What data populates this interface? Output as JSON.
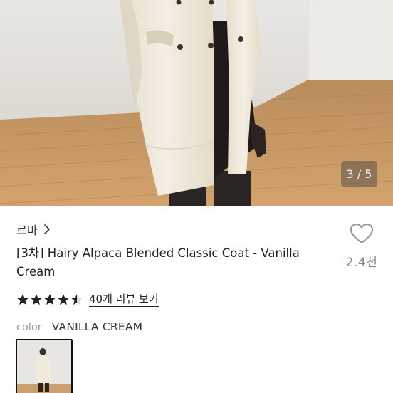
{
  "gallery": {
    "counter": "3 / 5"
  },
  "brand": {
    "name": "르바"
  },
  "product": {
    "title": "[3차] Hairy Alpaca Blended Classic Coat - Vanilla Cream",
    "wish_count": "2.4천"
  },
  "rating": {
    "value": 4.5,
    "out_of": 5,
    "review_link": "40개 리뷰 보기"
  },
  "option": {
    "label": "color",
    "value": "VANILLA CREAM"
  },
  "colors": {
    "star": "#222222",
    "heart_stroke": "#9a9a9a",
    "coat": "#efe9da",
    "floor": "#c89b64"
  },
  "icons": {
    "brand_chevron": "chevron-right-icon",
    "wish": "heart-outline-icon",
    "star": "star-icon"
  }
}
